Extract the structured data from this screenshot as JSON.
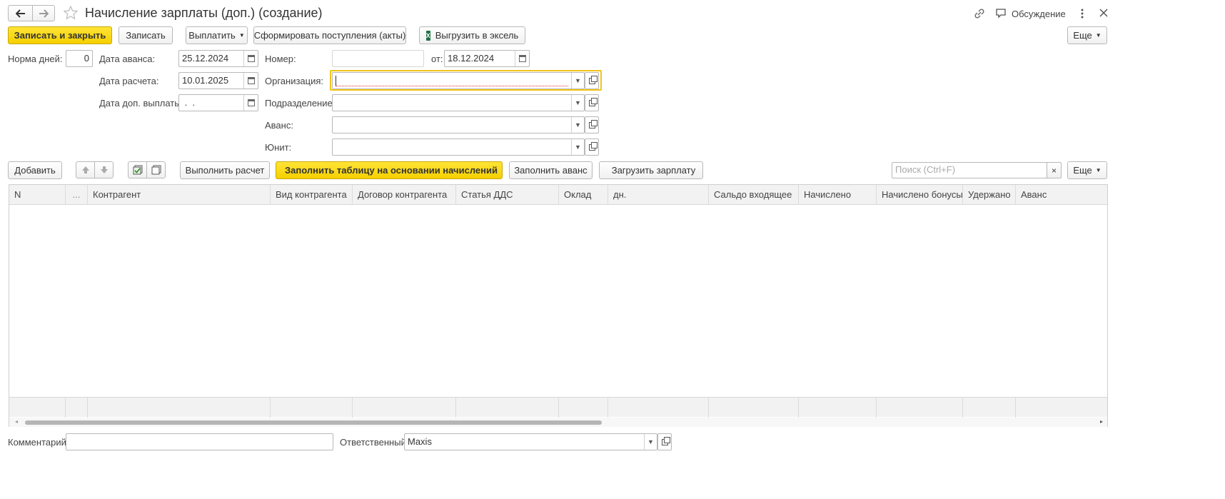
{
  "window": {
    "title": "Начисление зарплаты (доп.) (создание)",
    "discussion_label": "Обсуждение"
  },
  "toolbar": {
    "save_close": "Записать и закрыть",
    "save": "Записать",
    "pay": "Выплатить",
    "form_receipts": "Сформировать поступления (акты)",
    "export_excel": "Выгрузить в эксель",
    "more": "Еще"
  },
  "form": {
    "norm_days_label": "Норма дней:",
    "norm_days_value": "0",
    "advance_date_label": "Дата аванса:",
    "advance_date_value": "25.12.2024",
    "calc_date_label": "Дата расчета:",
    "calc_date_value": "10.01.2025",
    "extra_pay_date_label": "Дата доп. выплаты:",
    "extra_pay_date_value": " .  .",
    "number_label": "Номер:",
    "number_value": "",
    "from_label": "от:",
    "from_value": "18.12.2024",
    "org_label": "Организация:",
    "org_value": "",
    "division_label": "Подразделение:",
    "division_value": "",
    "advance_label": "Аванс:",
    "advance_value": "",
    "unit_label": "Юнит:",
    "unit_value": ""
  },
  "table_toolbar": {
    "add": "Добавить",
    "run_calc": "Выполнить расчет",
    "fill_table": "Заполнить таблицу на основании начислений",
    "fill_advance": "Заполнить аванс",
    "load_salary": "Загрузить зарплату",
    "search_placeholder": "Поиск (Ctrl+F)",
    "more": "Еще"
  },
  "table": {
    "columns": [
      "N",
      "...",
      "Контрагент",
      "Вид контрагента",
      "Договор контрагента",
      "Статья ДДС",
      "Оклад",
      "дн.",
      "Сальдо входящее",
      "Начислено",
      "Начислено бонусы",
      "Удержано",
      "Аванс"
    ],
    "rows": []
  },
  "footer": {
    "comment_label": "Комментарий:",
    "comment_value": "",
    "responsible_label": "Ответственный:",
    "responsible_value": "Maxis"
  },
  "colors": {
    "accent_yellow": "#f5d000",
    "focus_border": "#f0c419"
  }
}
